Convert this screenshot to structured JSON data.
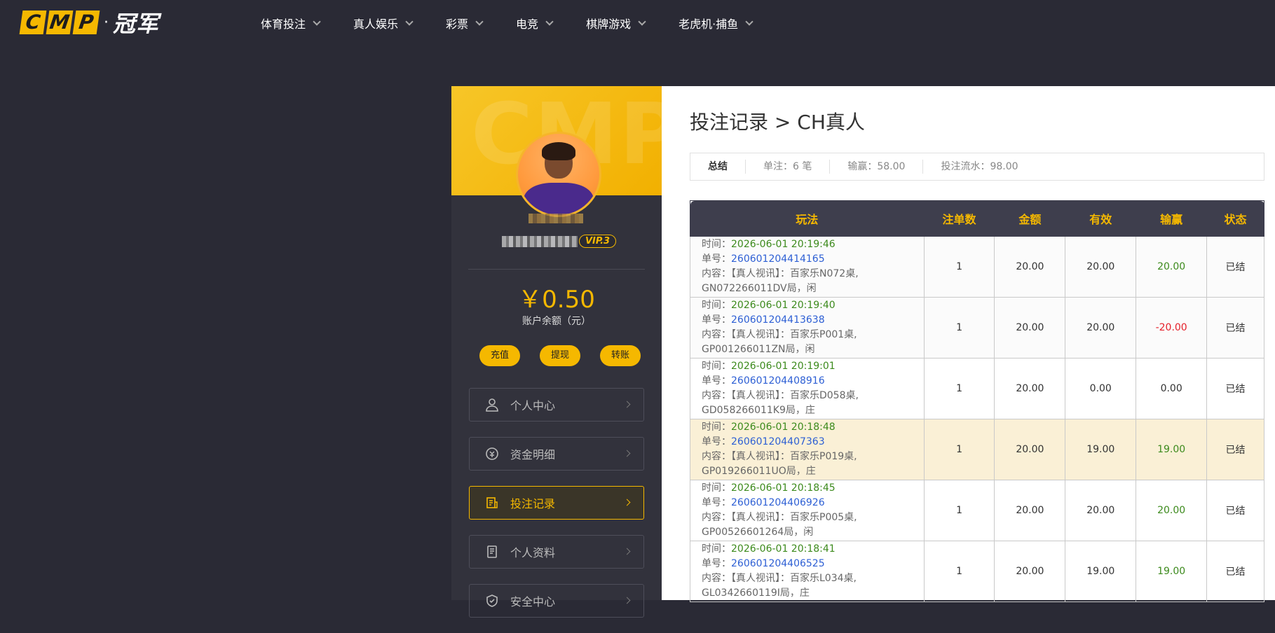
{
  "logo": {
    "letters": [
      "C",
      "M",
      "P"
    ],
    "dot": "·",
    "cn": "冠军"
  },
  "nav": [
    {
      "label": "体育投注"
    },
    {
      "label": "真人娱乐"
    },
    {
      "label": "彩票"
    },
    {
      "label": "电竞"
    },
    {
      "label": "棋牌游戏"
    },
    {
      "label": "老虎机·捕鱼"
    }
  ],
  "sidebar": {
    "banner_watermark": "CMP",
    "vip_badge": "VIP.3",
    "balance": "￥0.50",
    "balance_label": "账户余额（元）",
    "actions": {
      "deposit": "充值",
      "withdraw": "提现",
      "transfer": "转账"
    },
    "menu": [
      {
        "label": "个人中心",
        "icon": "user-icon"
      },
      {
        "label": "资金明细",
        "icon": "funds-icon"
      },
      {
        "label": "投注记录",
        "icon": "bet-record-icon",
        "active": true
      },
      {
        "label": "个人资料",
        "icon": "profile-icon"
      },
      {
        "label": "安全中心",
        "icon": "shield-icon"
      }
    ]
  },
  "main": {
    "title": "投注记录 > CH真人",
    "summary": {
      "title": "总结",
      "bets": "单注：6 笔",
      "winloss": "输赢：58.00",
      "turnover": "投注流水：98.00"
    },
    "table": {
      "headers": [
        "玩法",
        "注单数",
        "金额",
        "有效",
        "输赢",
        "状态"
      ],
      "labels": {
        "time": "时间：",
        "order": "单号：",
        "content": "内容："
      },
      "rows": [
        {
          "time": "2026-06-01 20:19:46",
          "order": "260601204414165",
          "content1": "【真人视讯】：百家乐N072桌,",
          "content2": "GN072266011DV局，闲",
          "count": "1",
          "amount": "20.00",
          "valid": "20.00",
          "win": "20.00",
          "win_type": "pos",
          "status": "已结"
        },
        {
          "time": "2026-06-01 20:19:40",
          "order": "260601204413638",
          "content1": "【真人视讯】：百家乐P001桌,",
          "content2": "GP001266011ZN局，闲",
          "count": "1",
          "amount": "20.00",
          "valid": "20.00",
          "win": "-20.00",
          "win_type": "neg",
          "status": "已结"
        },
        {
          "time": "2026-06-01 20:19:01",
          "order": "260601204408916",
          "content1": "【真人视讯】：百家乐D058桌,",
          "content2": "GD058266011K9局，庄",
          "count": "1",
          "amount": "20.00",
          "valid": "0.00",
          "win": "0.00",
          "win_type": "zero",
          "status": "已结"
        },
        {
          "time": "2026-06-01 20:18:48",
          "order": "260601204407363",
          "content1": "【真人视讯】：百家乐P019桌,",
          "content2": "GP019266011UO局，庄",
          "count": "1",
          "amount": "20.00",
          "valid": "19.00",
          "win": "19.00",
          "win_type": "pos",
          "status": "已结"
        },
        {
          "time": "2026-06-01 20:18:45",
          "order": "260601204406926",
          "content1": "【真人视讯】：百家乐P005桌,",
          "content2": "GP00526601264局，闲",
          "count": "1",
          "amount": "20.00",
          "valid": "20.00",
          "win": "20.00",
          "win_type": "pos",
          "status": "已结"
        },
        {
          "time": "2026-06-01 20:18:41",
          "order": "260601204406525",
          "content1": "【真人视讯】：百家乐L034桌,",
          "content2": "GL0342660119I局，庄",
          "count": "1",
          "amount": "20.00",
          "valid": "19.00",
          "win": "19.00",
          "win_type": "pos",
          "status": "已结"
        }
      ]
    }
  },
  "colors": {
    "accent": "#f5b800",
    "positive": "#3c8a1c",
    "negative": "#e5202a",
    "link": "#2d5fd4"
  }
}
